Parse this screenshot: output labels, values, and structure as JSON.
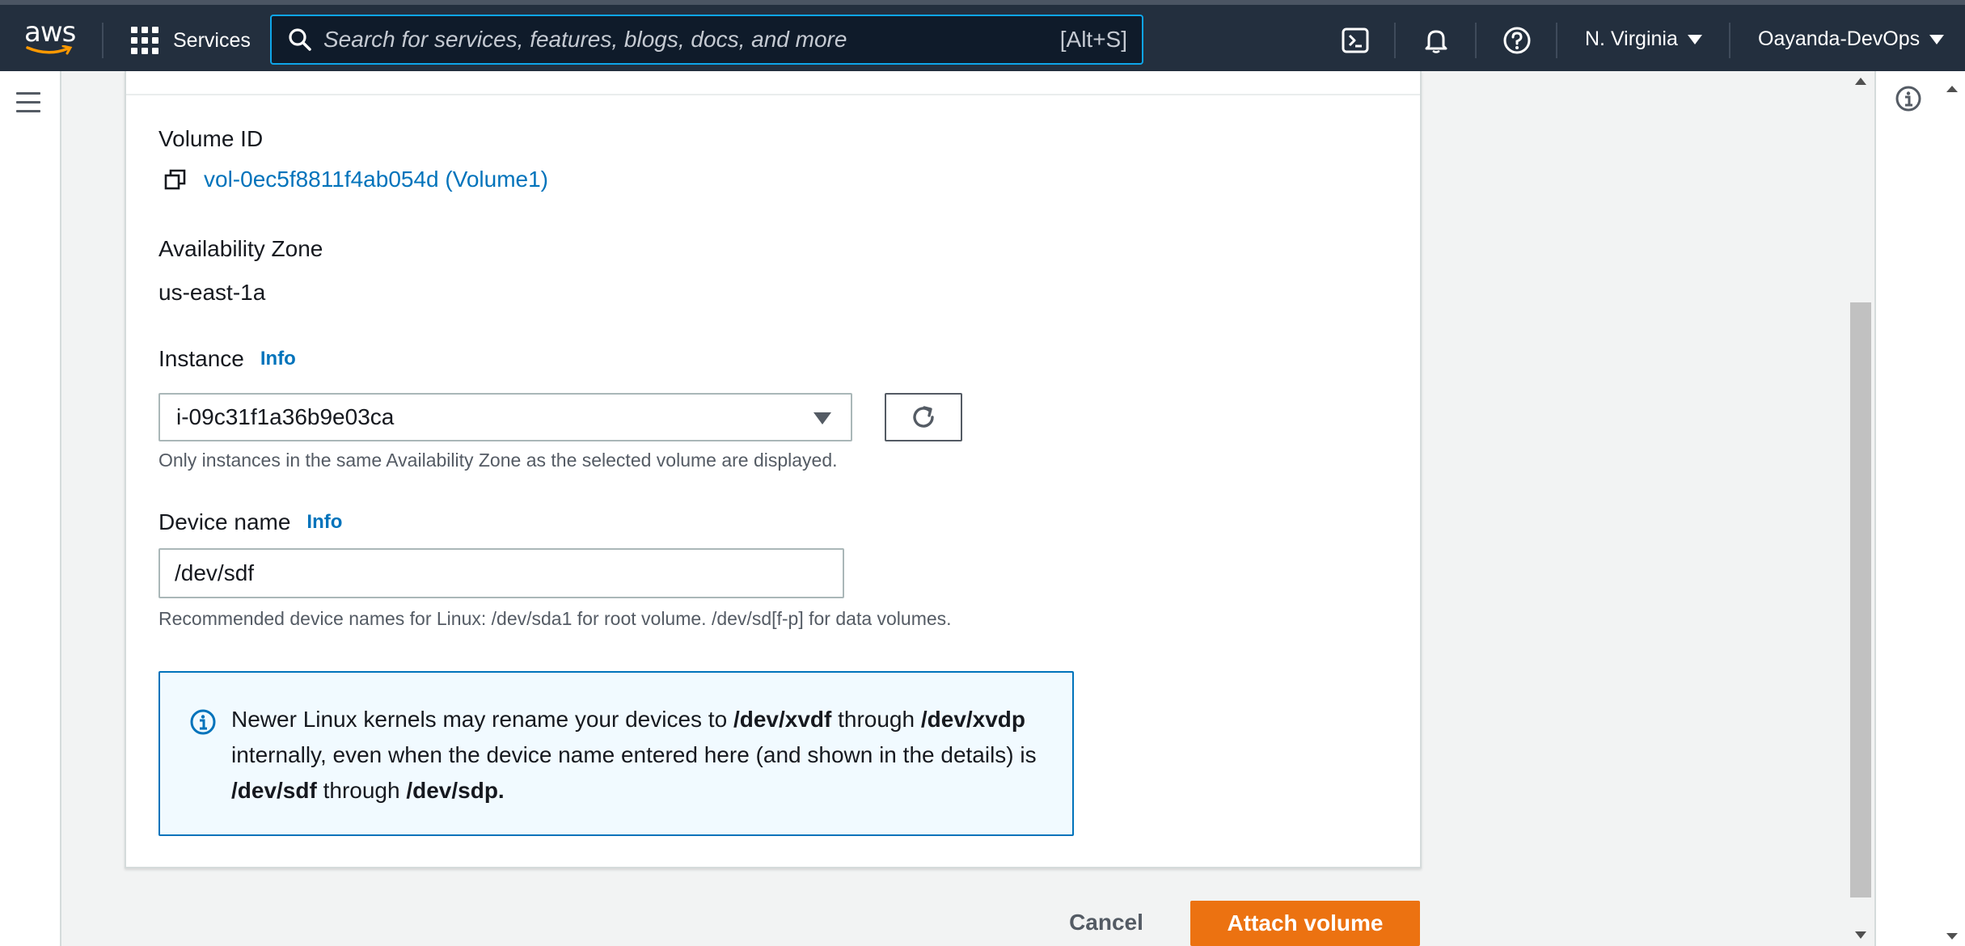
{
  "nav": {
    "logo": "aws",
    "services_label": "Services",
    "search_placeholder": "Search for services, features, blogs, docs, and more",
    "search_shortcut": "[Alt+S]",
    "region": "N. Virginia",
    "account": "Oayanda-DevOps",
    "icons": [
      "cloudshell-icon",
      "notifications-icon",
      "help-icon"
    ]
  },
  "form": {
    "volume_id_label": "Volume ID",
    "volume_id_value": "vol-0ec5f8811f4ab054d (Volume1)",
    "az_label": "Availability Zone",
    "az_value": "us-east-1a",
    "instance_label": "Instance",
    "instance_info": "Info",
    "instance_selected": "i-09c31f1a36b9e03ca",
    "instance_help": "Only instances in the same Availability Zone as the selected volume are displayed.",
    "device_label": "Device name",
    "device_info": "Info",
    "device_value": "/dev/sdf",
    "device_help": "Recommended device names for Linux: /dev/sda1 for root volume. /dev/sd[f-p] for data volumes."
  },
  "alert": {
    "t1": "Newer Linux kernels may rename your devices to ",
    "b1": "/dev/xvdf",
    "t2": " through ",
    "b2": "/dev/xvdp",
    "t3": " internally, even when the device name entered here (and shown in the details) is ",
    "b3": "/dev/sdf",
    "t4": " through ",
    "b4": "/dev/sdp."
  },
  "actions": {
    "cancel": "Cancel",
    "attach": "Attach volume"
  },
  "colors": {
    "nav_bg": "#232f3e",
    "link": "#0073bb",
    "primary_button": "#ec7211",
    "alert_bg": "#f1faff"
  }
}
